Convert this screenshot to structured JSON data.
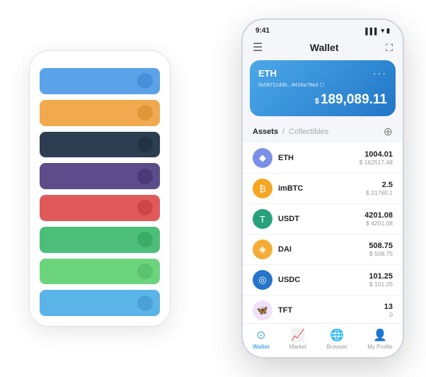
{
  "scene": {
    "bg_phone": {
      "strips": [
        {
          "color": "strip-blue",
          "dot": "dot-blue"
        },
        {
          "color": "strip-orange",
          "dot": "dot-orange"
        },
        {
          "color": "strip-dark",
          "dot": "dot-dark"
        },
        {
          "color": "strip-purple",
          "dot": "dot-purple"
        },
        {
          "color": "strip-red",
          "dot": "dot-red"
        },
        {
          "color": "strip-green",
          "dot": "dot-green"
        },
        {
          "color": "strip-light-green",
          "dot": "dot-lightgreen"
        },
        {
          "color": "strip-sky",
          "dot": "dot-sky"
        }
      ]
    },
    "fg_phone": {
      "status_bar": {
        "time": "9:41",
        "signal": "▌▌▌",
        "wifi": "WiFi",
        "battery": "🔋"
      },
      "header": {
        "menu_icon": "☰",
        "title": "Wallet",
        "expand_icon": "⛶"
      },
      "eth_card": {
        "label": "ETH",
        "dots": "···",
        "address": "0x08711d3b...8416a78a3 ⬡",
        "currency_symbol": "$",
        "balance": "189,089.11"
      },
      "assets_section": {
        "tab_active": "Assets",
        "separator": "/",
        "tab_inactive": "Collectibles",
        "add_icon": "⊕"
      },
      "asset_list": [
        {
          "icon": "◆",
          "icon_bg": "#7b8fe8",
          "icon_color": "#fff",
          "name": "ETH",
          "amount": "1004.01",
          "usd": "$ 162517.48"
        },
        {
          "icon": "₿",
          "icon_bg": "#f5a623",
          "icon_color": "#fff",
          "name": "imBTC",
          "amount": "2.5",
          "usd": "$ 21760.1"
        },
        {
          "icon": "T",
          "icon_bg": "#26a17b",
          "icon_color": "#fff",
          "name": "USDT",
          "amount": "4201.08",
          "usd": "$ 4201.08"
        },
        {
          "icon": "◈",
          "icon_bg": "#f5ac37",
          "icon_color": "#fff",
          "name": "DAI",
          "amount": "508.75",
          "usd": "$ 508.75"
        },
        {
          "icon": "◎",
          "icon_bg": "#2775ca",
          "icon_color": "#fff",
          "name": "USDC",
          "amount": "101.25",
          "usd": "$ 101.25"
        },
        {
          "icon": "🦋",
          "icon_bg": "#f0e0f8",
          "icon_color": "#c060d0",
          "name": "TFT",
          "amount": "13",
          "usd": "0"
        }
      ],
      "bottom_nav": [
        {
          "icon": "⊙",
          "label": "Wallet",
          "active": true
        },
        {
          "icon": "📈",
          "label": "Market",
          "active": false
        },
        {
          "icon": "🌐",
          "label": "Browser",
          "active": false
        },
        {
          "icon": "👤",
          "label": "My Profile",
          "active": false
        }
      ]
    }
  }
}
